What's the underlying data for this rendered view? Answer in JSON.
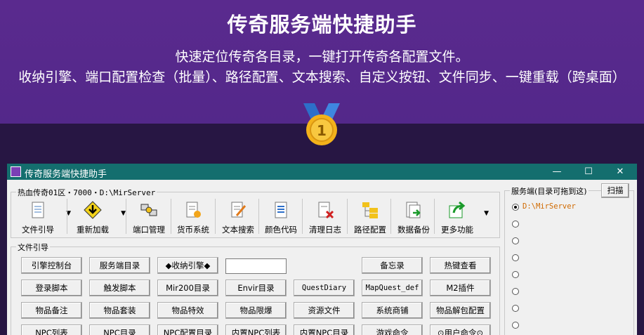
{
  "banner": {
    "title": "传奇服务端快捷助手",
    "subtitle1": "快速定位传奇各目录，一键打开传奇各配置文件。",
    "subtitle2": "收纳引擎、端口配置检查（批量）、路径配置、文本搜索、自定义按钮、文件同步、一键重载（跨桌面）"
  },
  "window": {
    "title": "传奇服务端快捷助手",
    "controls": {
      "minimize": "—",
      "maximize": "☐",
      "close": "✕"
    },
    "toolbar_group": "热血传奇01区・7000・D:\\MirServer",
    "toolbar": [
      {
        "label": "文件引导",
        "icon": "file-icon",
        "dropdown": true
      },
      {
        "label": "重新加载",
        "icon": "warning-download-icon",
        "dropdown": true
      },
      {
        "label": "端口管理",
        "icon": "network-port-icon",
        "dropdown": false
      },
      {
        "label": "货币系统",
        "icon": "currency-doc-icon",
        "dropdown": false
      },
      {
        "label": "文本搜索",
        "icon": "edit-doc-icon",
        "dropdown": false
      },
      {
        "label": "颜色代码",
        "icon": "color-doc-icon",
        "dropdown": false
      },
      {
        "label": "清理日志",
        "icon": "delete-doc-icon",
        "dropdown": false
      },
      {
        "label": "路径配置",
        "icon": "folder-tree-icon",
        "dropdown": false
      },
      {
        "label": "数据备份",
        "icon": "backup-icon",
        "dropdown": false
      },
      {
        "label": "更多功能",
        "icon": "share-arrow-icon",
        "dropdown": true
      }
    ],
    "file_group": "文件引导",
    "buttons": {
      "row1": [
        "引擎控制台",
        "服务端目录",
        "◆收纳引擎◆"
      ],
      "row1_right": [
        "备忘录",
        "热键查看"
      ],
      "row2": [
        "登录脚本",
        "触发脚本",
        "Mir200目录",
        "Envir目录",
        "QuestDiary",
        "MapQuest_def",
        "M2插件"
      ],
      "row3": [
        "物品备注",
        "物品套装",
        "物品特效",
        "物品限爆",
        "资源文件",
        "系统商铺",
        "物品解包配置"
      ],
      "row4": [
        "NPC列表",
        "NPC目录",
        "NPC配置目录",
        "内置NPC列表",
        "内置NPC目录",
        "游戏命令",
        "⊙用户命令⊙"
      ]
    },
    "search_input": {
      "value": ""
    },
    "server_group": "服务端(目录可拖到这)",
    "scan_button": "扫描",
    "server_list": [
      "D:\\MirServer",
      "",
      "",
      "",
      "",
      "",
      "",
      ""
    ]
  },
  "colors": {
    "banner": "#5a2a8e",
    "titlebar": "#146e6e",
    "path_text": "#d06a00"
  }
}
